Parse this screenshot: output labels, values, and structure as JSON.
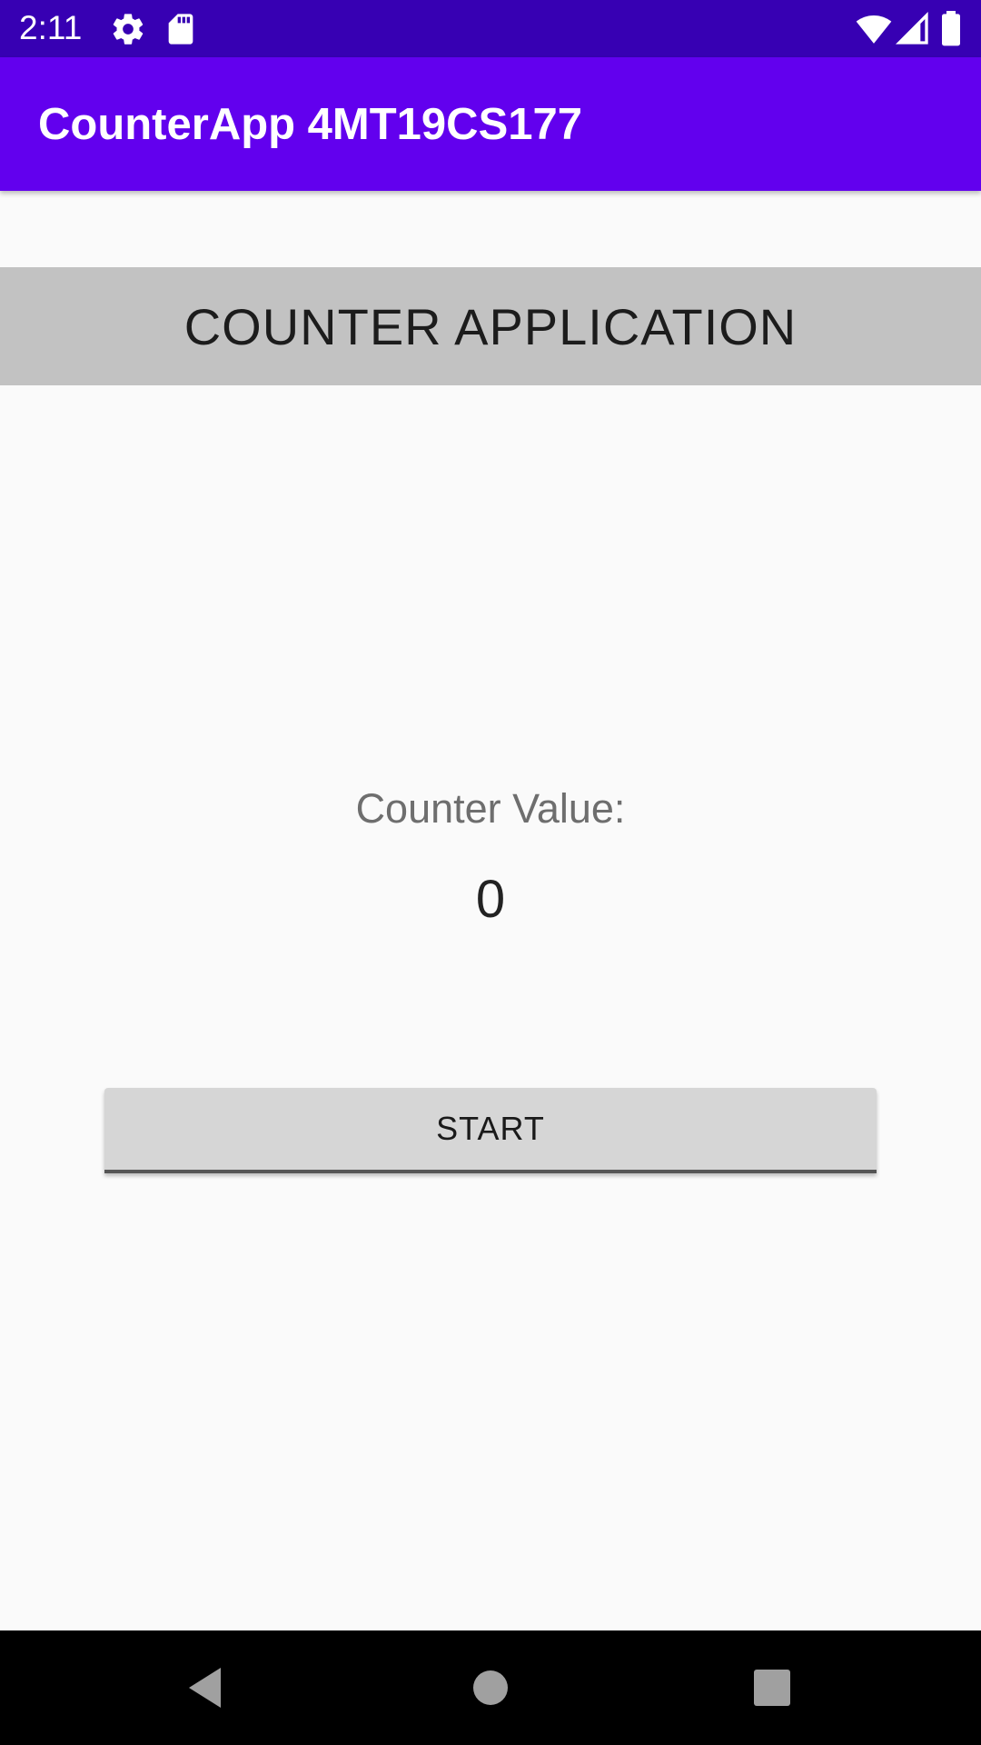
{
  "status_bar": {
    "time": "2:11",
    "left_icons": [
      "gear-icon",
      "sd-card-icon"
    ],
    "right_icons": [
      "wifi-icon",
      "cellular-signal-icon",
      "battery-icon"
    ],
    "background": "#3700b3"
  },
  "app_bar": {
    "title": "CounterApp 4MT19CS177",
    "background": "#6200ee"
  },
  "header": {
    "text": "COUNTER APPLICATION",
    "background": "#c2c2c2"
  },
  "counter": {
    "label": "Counter Value:",
    "value": "0"
  },
  "start_button": {
    "label": "START"
  },
  "nav_bar": {
    "buttons": [
      "back-icon",
      "home-icon",
      "recents-icon"
    ]
  }
}
